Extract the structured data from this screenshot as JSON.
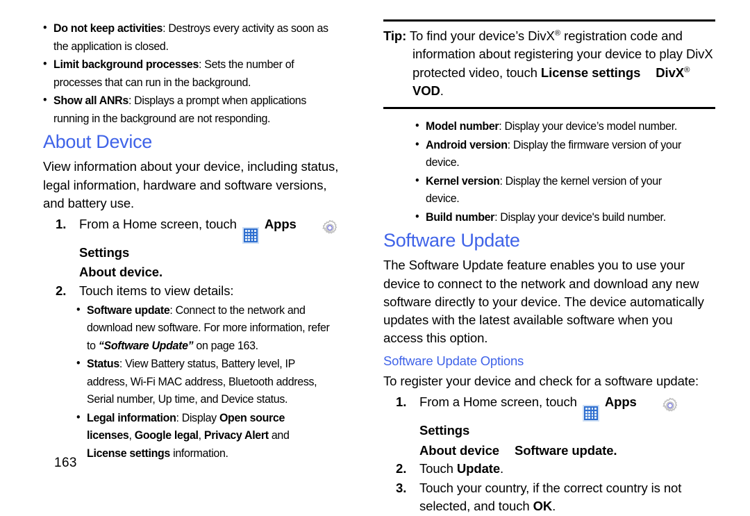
{
  "document": {
    "page_number": "163"
  },
  "left_column": {
    "top_bullets": [
      {
        "term": "Do not keep activities",
        "rest": ": Destroys every activity as soon as the application is closed."
      },
      {
        "term": "Limit background processes",
        "rest": ": Sets the number of processes that can run in the background."
      },
      {
        "term": "Show all ANRs",
        "rest": ": Displays a prompt when applications running in the background are not responding."
      }
    ],
    "heading": "About Device",
    "intro": "View information about your device, including status, legal information, hardware and software versions, and battery use.",
    "steps": [
      {
        "num": "1.",
        "text_before_apps": "From a Home screen, touch",
        "apps_label": "Apps",
        "settings_label": "Settings",
        "sub_line": "About device."
      },
      {
        "num": "2.",
        "text": "Touch items to view details:"
      }
    ],
    "detail_bullets": [
      {
        "term": "Software update",
        "rest": ": Connect to the network and download new software. For more information, refer to ",
        "italic": "“Software Update”",
        "tail": " on page 163."
      },
      {
        "term": "Status",
        "rest": ": View Battery status, Battery level, IP address, Wi-Fi MAC address, Bluetooth address, Serial number, Up time, and Device status."
      },
      {
        "term": "Legal information",
        "rest": ": Display ",
        "bold_parts": [
          "Open source licenses",
          "Google legal",
          "Privacy Alert",
          "License settings"
        ],
        "separators": [
          ", ",
          ", ",
          " and "
        ],
        "tail": " information."
      }
    ]
  },
  "right_column": {
    "tip": {
      "label": "Tip:",
      "line1_a": "To find your device’s DivX",
      "line1_sup": "®",
      "line1_b": " registration code and",
      "line2": "information about registering your device to play DivX",
      "line3_a": "protected video, touch ",
      "line3_bold1": "License settings",
      "line3_bold2_a": "DivX",
      "line3_sup": "®",
      "line3_bold2_b": " VOD",
      "line3_tail": "."
    },
    "info_bullets": [
      {
        "term": "Model number",
        "rest": ": Display your device’s model number."
      },
      {
        "term": "Android version",
        "rest": ": Display the firmware version of your device."
      },
      {
        "term": "Kernel version",
        "rest": ": Display the kernel version of your device."
      },
      {
        "term": "Build number",
        "rest": ": Display your device's build number."
      }
    ],
    "heading": "Software Update",
    "paragraph": "The Software Update feature enables you to use your device to connect to the network and download any new software directly to your device. The device automatically updates with the latest available software when you access this option.",
    "subheading": "Software Update Options",
    "lead_in": "To register your device and check for a software update:",
    "steps": [
      {
        "num": "1.",
        "text_before_apps": "From a Home screen, touch",
        "apps_label": "Apps",
        "settings_label": "Settings",
        "sub_a": "About device",
        "sub_b": "Software update",
        "sub_tail": "."
      },
      {
        "num": "2.",
        "text_a": "Touch ",
        "bold": "Update",
        "text_b": "."
      },
      {
        "num": "3.",
        "text_a": "Touch your country, if the correct country is not selected, and touch ",
        "bold": "OK",
        "text_b": "."
      }
    ]
  },
  "icons": {
    "apps": "apps-grid-icon",
    "settings": "gear-icon"
  },
  "colors": {
    "heading_blue": "#3f63e8",
    "apps_icon_blue": "#2f6fd0",
    "gear_outline": "#bdbdbd",
    "gear_ring_blue": "#6f6fd8",
    "text_black": "#000000"
  }
}
